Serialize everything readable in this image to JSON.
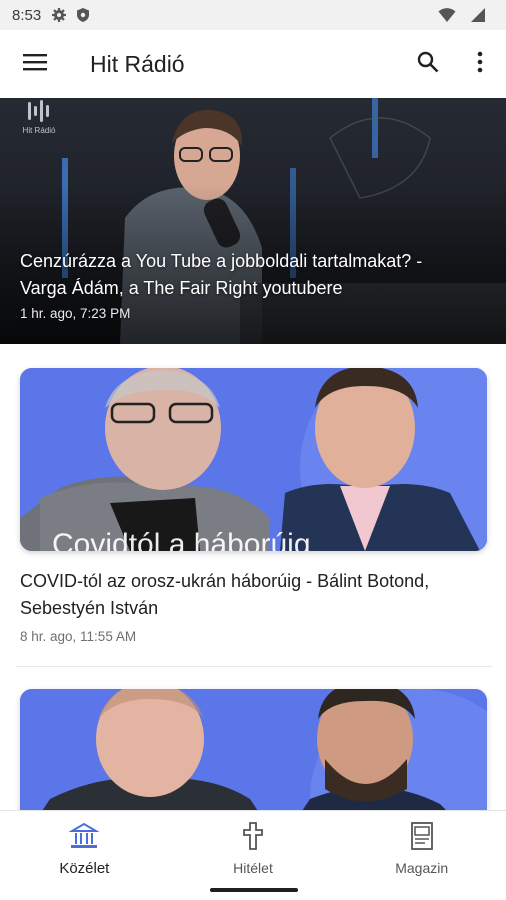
{
  "status_bar": {
    "time": "8:53",
    "icons": [
      "gear-icon",
      "shield-icon",
      "wifi-icon",
      "signal-icon"
    ]
  },
  "app_bar": {
    "title": "Hit Rádió",
    "icons": [
      "menu-icon",
      "search-icon",
      "more-vert-icon"
    ]
  },
  "hero": {
    "logo_text": "Hit Rádió",
    "title": "Cenzúrázza a You Tube a jobboldali tartalmakat? - Varga Ádám, a The Fair Right youtubere",
    "time": "1 hr. ago, 7:23 PM"
  },
  "articles": [
    {
      "image_text": "Covidtól a háborúig",
      "title": "COVID-tól az orosz-ukrán háborúig - Bálint Botond, Sebestyén István",
      "time": "8 hr. ago, 11:55 AM"
    },
    {
      "image_text": "",
      "title": "",
      "time": ""
    }
  ],
  "bottom_nav": {
    "items": [
      {
        "label": "Közélet",
        "icon": "building-icon",
        "active": true
      },
      {
        "label": "Hitélet",
        "icon": "cross-icon",
        "active": false
      },
      {
        "label": "Magazin",
        "icon": "magazine-icon",
        "active": false
      }
    ]
  },
  "colors": {
    "accent": "#4a6fd8",
    "card_bg": "#5b76e8",
    "status_bar": "#f1f1f1",
    "hero_bg": "#1b1d22"
  }
}
